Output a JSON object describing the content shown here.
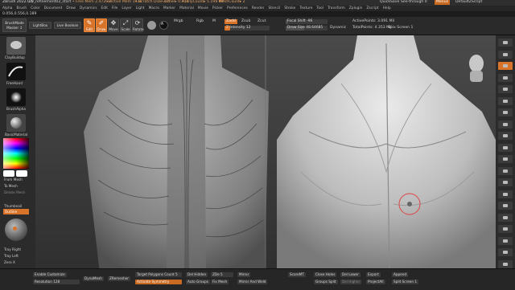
{
  "titlebar": {
    "app": "ZBrush 2022.0.5",
    "file": "20_refinement02_start",
    "free_mem": "• Free Mem 2.472GB",
    "active_mem": "• Active Mem 1936",
    "scratch": "• Scratch Disk 374",
    "timer": "• Timer▸ 0.002",
    "polycount": "• PolyCount▸ 5.195 MP",
    "meshcount": "• MeshCount▸ 2",
    "quicksave": "QuickSave",
    "see_through": "See-through 0",
    "menus_btn": "Menus",
    "script": "DefaultZScript"
  },
  "menubar": [
    "Alpha",
    "Brush",
    "Color",
    "Document",
    "Draw",
    "Dynamics",
    "Edit",
    "File",
    "Layer",
    "Light",
    "Macro",
    "Marker",
    "Material",
    "Movie",
    "Picker",
    "Preferences",
    "Render",
    "Stencil",
    "Stroke",
    "Texture",
    "Tool",
    "Transform",
    "Zplugin",
    "Zscript",
    "Help"
  ],
  "coordline": "0.056,0.556,0.189",
  "toolbar": {
    "brush_name": "BrushMode",
    "brush_sub": "Masker ↕",
    "lightbox": "LightBox",
    "live_boolean": "Live Boolean",
    "edit": "Edit",
    "draw": "Draw",
    "move": "Move",
    "scale": "Scale",
    "rotate": "Rotate",
    "a_label": "A",
    "mrgb": "Mrgb",
    "rgb": "Rgb",
    "m": "M",
    "zadd": "Zadd",
    "zsub": "Zsub",
    "zcut": "Zcut",
    "z_intensity": "Z Intensity 12",
    "focal_shift": "Focal Shift -96",
    "draw_size": "Draw Size 48.64685",
    "active_points": "ActivePoints: 3.091 Mil",
    "total_points": "TotalPoints: 4.353 Mil",
    "dynamic": "Dynamic",
    "spin_screen": "Spix Screen 1"
  },
  "left_shelf": {
    "brush1": "ClayBuildup",
    "brush2": "FreeHand",
    "brush3": "BrushAlpha",
    "material": "BasicMaterial",
    "from_mesh": "From Mesh",
    "to_mesh": "To Mesh",
    "delete_mesh": "Delete Mesh",
    "thumbnail": "Thumbnail",
    "outline": "Outline",
    "tray_right": "Tray Right",
    "tray_left": "Tray Left",
    "zero_x": "Zero X"
  },
  "right_shelf_icons": [
    "bpr-icon",
    "spix-icon",
    "scroll-icon",
    "zoom-icon",
    "actual-icon",
    "aahalf-icon",
    "persp-icon",
    "floor-icon",
    "local-icon",
    "lsym-icon",
    "frame-icon",
    "move-icon",
    "scale-icon",
    "rotate-icon",
    "linefill-icon",
    "transp-icon",
    "ghost-icon",
    "solo-icon",
    "xpose-icon",
    "dynamic-icon"
  ],
  "bottom": {
    "enable_customize": "Enable Customize",
    "resolution": "Resolution 128",
    "dynamesh": "DynaMesh",
    "zremesher": "ZRemesher",
    "target_poly": "Target Polygons Count 5",
    "activate_symmetry": "Activate Symmetry",
    "del_hidden": "Del Hidden",
    "auto_groups": "Auto Groups",
    "zde": "ZDe 5",
    "fix_mesh": "Fix Mesh",
    "mirror": "Mirror",
    "mirror_weld": "Mirror And Weld",
    "score": "ScoreMT",
    "close_holes": "Close Holes",
    "groups_split": "Groups Split",
    "del_lower": "Del Lower",
    "del_higher": "Del Higher",
    "export": "Export",
    "projectall": "ProjectAll",
    "append": "Append",
    "split_screen": "Split Screen 1"
  },
  "colors": {
    "accent": "#d8742a",
    "panel": "#2b2b2b",
    "canvas": "#3d3d3d"
  }
}
